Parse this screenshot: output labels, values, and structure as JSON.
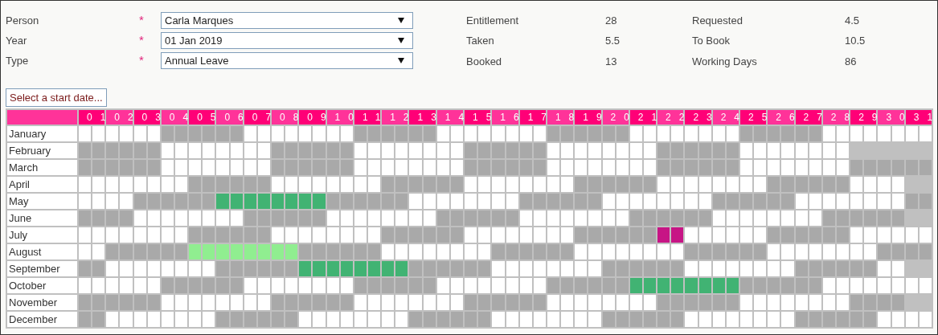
{
  "form": [
    {
      "label": "Person",
      "required_mark": "*",
      "value": "Carla Marques"
    },
    {
      "label": "Year",
      "required_mark": "*",
      "value": "01 Jan 2019"
    },
    {
      "label": "Type",
      "required_mark": "*",
      "value": "Annual Leave"
    }
  ],
  "stats": [
    {
      "label": "Entitlement",
      "value": "28"
    },
    {
      "label": "Requested",
      "value": "4.5"
    },
    {
      "label": "Taken",
      "value": "5.5"
    },
    {
      "label": "To Book",
      "value": "10.5"
    },
    {
      "label": "Booked",
      "value": "13"
    },
    {
      "label": "Working Days",
      "value": "86"
    }
  ],
  "start_button": "Select a start date...",
  "day_headers": [
    "01",
    "02",
    "03",
    "04",
    "05",
    "06",
    "07",
    "08",
    "09",
    "10",
    "11",
    "12",
    "13",
    "14",
    "15",
    "16",
    "17",
    "18",
    "19",
    "20",
    "21",
    "22",
    "23",
    "24",
    "25",
    "26",
    "27",
    "28",
    "29",
    "30",
    "31"
  ],
  "months": [
    {
      "name": "January",
      "days": [
        {
          "kind": "work"
        },
        {
          "kind": "work"
        },
        {
          "kind": "work"
        },
        {
          "kind": "off"
        },
        {
          "kind": "off"
        },
        {
          "kind": "off"
        },
        {
          "kind": "work"
        },
        {
          "kind": "work"
        },
        {
          "kind": "work"
        },
        {
          "kind": "work"
        },
        {
          "kind": "off"
        },
        {
          "kind": "off"
        },
        {
          "kind": "off"
        },
        {
          "kind": "work"
        },
        {
          "kind": "work"
        },
        {
          "kind": "work"
        },
        {
          "kind": "work"
        },
        {
          "kind": "off"
        },
        {
          "kind": "off"
        },
        {
          "kind": "off"
        },
        {
          "kind": "work"
        },
        {
          "kind": "work"
        },
        {
          "kind": "work"
        },
        {
          "kind": "work"
        },
        {
          "kind": "off"
        },
        {
          "kind": "off"
        },
        {
          "kind": "off"
        },
        {
          "kind": "work"
        },
        {
          "kind": "work"
        },
        {
          "kind": "work"
        },
        {
          "kind": "work"
        }
      ]
    },
    {
      "name": "February",
      "days": [
        {
          "kind": "off"
        },
        {
          "kind": "off"
        },
        {
          "kind": "off"
        },
        {
          "kind": "work"
        },
        {
          "kind": "work"
        },
        {
          "kind": "work"
        },
        {
          "kind": "work"
        },
        {
          "kind": "off"
        },
        {
          "kind": "off"
        },
        {
          "kind": "off"
        },
        {
          "kind": "work"
        },
        {
          "kind": "work"
        },
        {
          "kind": "work"
        },
        {
          "kind": "work"
        },
        {
          "kind": "off"
        },
        {
          "kind": "off"
        },
        {
          "kind": "off"
        },
        {
          "kind": "work"
        },
        {
          "kind": "work"
        },
        {
          "kind": "work"
        },
        {
          "kind": "work"
        },
        {
          "kind": "off"
        },
        {
          "kind": "off"
        },
        {
          "kind": "off"
        },
        {
          "kind": "work"
        },
        {
          "kind": "work"
        },
        {
          "kind": "work"
        },
        {
          "kind": "work"
        },
        {
          "kind": "none"
        },
        {
          "kind": "none"
        },
        {
          "kind": "none"
        }
      ]
    },
    {
      "name": "March",
      "days": [
        {
          "kind": "off"
        },
        {
          "kind": "off"
        },
        {
          "kind": "off"
        },
        {
          "kind": "work"
        },
        {
          "kind": "work"
        },
        {
          "kind": "work"
        },
        {
          "kind": "work"
        },
        {
          "kind": "off"
        },
        {
          "kind": "off"
        },
        {
          "kind": "off"
        },
        {
          "kind": "work"
        },
        {
          "kind": "work"
        },
        {
          "kind": "work"
        },
        {
          "kind": "work"
        },
        {
          "kind": "off"
        },
        {
          "kind": "off"
        },
        {
          "kind": "off"
        },
        {
          "kind": "work"
        },
        {
          "kind": "work"
        },
        {
          "kind": "work"
        },
        {
          "kind": "work"
        },
        {
          "kind": "off"
        },
        {
          "kind": "off"
        },
        {
          "kind": "off"
        },
        {
          "kind": "work"
        },
        {
          "kind": "work"
        },
        {
          "kind": "work"
        },
        {
          "kind": "work"
        },
        {
          "kind": "off"
        },
        {
          "kind": "off"
        },
        {
          "kind": "off"
        }
      ]
    },
    {
      "name": "April",
      "days": [
        {
          "kind": "work"
        },
        {
          "kind": "work"
        },
        {
          "kind": "work"
        },
        {
          "kind": "work"
        },
        {
          "kind": "off"
        },
        {
          "kind": "off"
        },
        {
          "kind": "off"
        },
        {
          "kind": "work"
        },
        {
          "kind": "work"
        },
        {
          "kind": "work"
        },
        {
          "kind": "work"
        },
        {
          "kind": "off"
        },
        {
          "kind": "off"
        },
        {
          "kind": "off"
        },
        {
          "kind": "work"
        },
        {
          "kind": "work"
        },
        {
          "kind": "work"
        },
        {
          "kind": "work"
        },
        {
          "kind": "off"
        },
        {
          "kind": "off"
        },
        {
          "kind": "off"
        },
        {
          "kind": "work"
        },
        {
          "kind": "work"
        },
        {
          "kind": "work"
        },
        {
          "kind": "work"
        },
        {
          "kind": "off"
        },
        {
          "kind": "off"
        },
        {
          "kind": "off"
        },
        {
          "kind": "work"
        },
        {
          "kind": "work"
        },
        {
          "kind": "none"
        }
      ]
    },
    {
      "name": "May",
      "days": [
        {
          "kind": "work"
        },
        {
          "kind": "work"
        },
        {
          "kind": "off"
        },
        {
          "kind": "off"
        },
        {
          "kind": "off"
        },
        {
          "kind": "booked"
        },
        {
          "kind": "booked"
        },
        {
          "kind": "booked"
        },
        {
          "kind": "booked"
        },
        {
          "kind": "off"
        },
        {
          "kind": "off"
        },
        {
          "kind": "off"
        },
        {
          "kind": "work"
        },
        {
          "kind": "work"
        },
        {
          "kind": "work"
        },
        {
          "kind": "work"
        },
        {
          "kind": "off"
        },
        {
          "kind": "off"
        },
        {
          "kind": "off"
        },
        {
          "kind": "work"
        },
        {
          "kind": "work"
        },
        {
          "kind": "work"
        },
        {
          "kind": "work"
        },
        {
          "kind": "off"
        },
        {
          "kind": "off"
        },
        {
          "kind": "off"
        },
        {
          "kind": "work"
        },
        {
          "kind": "work"
        },
        {
          "kind": "work"
        },
        {
          "kind": "work"
        },
        {
          "kind": "off"
        }
      ]
    },
    {
      "name": "June",
      "days": [
        {
          "kind": "off"
        },
        {
          "kind": "off"
        },
        {
          "kind": "work"
        },
        {
          "kind": "work"
        },
        {
          "kind": "work"
        },
        {
          "kind": "work"
        },
        {
          "kind": "off"
        },
        {
          "kind": "off"
        },
        {
          "kind": "off"
        },
        {
          "kind": "work"
        },
        {
          "kind": "work"
        },
        {
          "kind": "work"
        },
        {
          "kind": "work"
        },
        {
          "kind": "off"
        },
        {
          "kind": "off"
        },
        {
          "kind": "off"
        },
        {
          "kind": "work"
        },
        {
          "kind": "work"
        },
        {
          "kind": "work"
        },
        {
          "kind": "work"
        },
        {
          "kind": "off"
        },
        {
          "kind": "off"
        },
        {
          "kind": "off"
        },
        {
          "kind": "work"
        },
        {
          "kind": "work"
        },
        {
          "kind": "work"
        },
        {
          "kind": "work"
        },
        {
          "kind": "off"
        },
        {
          "kind": "off"
        },
        {
          "kind": "off"
        },
        {
          "kind": "none"
        }
      ]
    },
    {
      "name": "July",
      "days": [
        {
          "kind": "work"
        },
        {
          "kind": "work"
        },
        {
          "kind": "work"
        },
        {
          "kind": "work"
        },
        {
          "kind": "off"
        },
        {
          "kind": "off"
        },
        {
          "kind": "off"
        },
        {
          "kind": "work"
        },
        {
          "kind": "work"
        },
        {
          "kind": "work"
        },
        {
          "kind": "work"
        },
        {
          "kind": "off"
        },
        {
          "kind": "off"
        },
        {
          "kind": "off"
        },
        {
          "kind": "work"
        },
        {
          "kind": "work"
        },
        {
          "kind": "work"
        },
        {
          "kind": "work"
        },
        {
          "kind": "off"
        },
        {
          "kind": "off"
        },
        {
          "kind": "off"
        },
        {
          "kind": "requested"
        },
        {
          "kind": "work"
        },
        {
          "kind": "work"
        },
        {
          "kind": "work"
        },
        {
          "kind": "off"
        },
        {
          "kind": "off"
        },
        {
          "kind": "off"
        },
        {
          "kind": "work"
        },
        {
          "kind": "work"
        },
        {
          "kind": "work"
        }
      ]
    },
    {
      "name": "August",
      "days": [
        {
          "kind": "work"
        },
        {
          "kind": "off"
        },
        {
          "kind": "off"
        },
        {
          "kind": "off"
        },
        {
          "kind": "taken"
        },
        {
          "kind": "taken"
        },
        {
          "kind": "taken"
        },
        {
          "kind": "taken"
        },
        {
          "kind": "off"
        },
        {
          "kind": "off"
        },
        {
          "kind": "off"
        },
        {
          "kind": "work"
        },
        {
          "kind": "work"
        },
        {
          "kind": "work"
        },
        {
          "kind": "work"
        },
        {
          "kind": "off"
        },
        {
          "kind": "off"
        },
        {
          "kind": "off"
        },
        {
          "kind": "work"
        },
        {
          "kind": "work"
        },
        {
          "kind": "work"
        },
        {
          "kind": "work"
        },
        {
          "kind": "off"
        },
        {
          "kind": "off"
        },
        {
          "kind": "off"
        },
        {
          "kind": "work"
        },
        {
          "kind": "work"
        },
        {
          "kind": "work"
        },
        {
          "kind": "work"
        },
        {
          "kind": "off"
        },
        {
          "kind": "off"
        }
      ]
    },
    {
      "name": "September",
      "days": [
        {
          "kind": "off"
        },
        {
          "kind": "work"
        },
        {
          "kind": "work"
        },
        {
          "kind": "work"
        },
        {
          "kind": "work"
        },
        {
          "kind": "off"
        },
        {
          "kind": "off"
        },
        {
          "kind": "off"
        },
        {
          "kind": "booked"
        },
        {
          "kind": "booked"
        },
        {
          "kind": "booked"
        },
        {
          "kind": "booked"
        },
        {
          "kind": "off"
        },
        {
          "kind": "off"
        },
        {
          "kind": "off"
        },
        {
          "kind": "work"
        },
        {
          "kind": "work"
        },
        {
          "kind": "work"
        },
        {
          "kind": "work"
        },
        {
          "kind": "off"
        },
        {
          "kind": "off"
        },
        {
          "kind": "off"
        },
        {
          "kind": "work"
        },
        {
          "kind": "work"
        },
        {
          "kind": "work"
        },
        {
          "kind": "work"
        },
        {
          "kind": "off"
        },
        {
          "kind": "off"
        },
        {
          "kind": "off"
        },
        {
          "kind": "work"
        },
        {
          "kind": "none"
        }
      ]
    },
    {
      "name": "October",
      "days": [
        {
          "kind": "work"
        },
        {
          "kind": "work"
        },
        {
          "kind": "work"
        },
        {
          "kind": "off"
        },
        {
          "kind": "off"
        },
        {
          "kind": "off"
        },
        {
          "kind": "work"
        },
        {
          "kind": "work"
        },
        {
          "kind": "work"
        },
        {
          "kind": "work"
        },
        {
          "kind": "off"
        },
        {
          "kind": "off"
        },
        {
          "kind": "off"
        },
        {
          "kind": "work"
        },
        {
          "kind": "work"
        },
        {
          "kind": "work"
        },
        {
          "kind": "work"
        },
        {
          "kind": "off"
        },
        {
          "kind": "off"
        },
        {
          "kind": "off"
        },
        {
          "kind": "booked"
        },
        {
          "kind": "booked"
        },
        {
          "kind": "booked"
        },
        {
          "kind": "booked"
        },
        {
          "kind": "off"
        },
        {
          "kind": "off"
        },
        {
          "kind": "off"
        },
        {
          "kind": "work"
        },
        {
          "kind": "work"
        },
        {
          "kind": "work"
        },
        {
          "kind": "work"
        }
      ]
    },
    {
      "name": "November",
      "days": [
        {
          "kind": "off"
        },
        {
          "kind": "off"
        },
        {
          "kind": "off"
        },
        {
          "kind": "work"
        },
        {
          "kind": "work"
        },
        {
          "kind": "work"
        },
        {
          "kind": "work"
        },
        {
          "kind": "off"
        },
        {
          "kind": "off"
        },
        {
          "kind": "off"
        },
        {
          "kind": "work"
        },
        {
          "kind": "work"
        },
        {
          "kind": "work"
        },
        {
          "kind": "work"
        },
        {
          "kind": "off"
        },
        {
          "kind": "off"
        },
        {
          "kind": "off"
        },
        {
          "kind": "work"
        },
        {
          "kind": "work"
        },
        {
          "kind": "work"
        },
        {
          "kind": "work"
        },
        {
          "kind": "off"
        },
        {
          "kind": "off"
        },
        {
          "kind": "off"
        },
        {
          "kind": "work"
        },
        {
          "kind": "work"
        },
        {
          "kind": "work"
        },
        {
          "kind": "work"
        },
        {
          "kind": "off"
        },
        {
          "kind": "off"
        },
        {
          "kind": "none"
        }
      ]
    },
    {
      "name": "December",
      "days": [
        {
          "kind": "off"
        },
        {
          "kind": "work"
        },
        {
          "kind": "work"
        },
        {
          "kind": "work"
        },
        {
          "kind": "work"
        },
        {
          "kind": "off"
        },
        {
          "kind": "off"
        },
        {
          "kind": "off"
        },
        {
          "kind": "work"
        },
        {
          "kind": "work"
        },
        {
          "kind": "work"
        },
        {
          "kind": "work"
        },
        {
          "kind": "off"
        },
        {
          "kind": "off"
        },
        {
          "kind": "off"
        },
        {
          "kind": "work"
        },
        {
          "kind": "work"
        },
        {
          "kind": "work"
        },
        {
          "kind": "work"
        },
        {
          "kind": "off"
        },
        {
          "kind": "off"
        },
        {
          "kind": "off"
        },
        {
          "kind": "work"
        },
        {
          "kind": "work"
        },
        {
          "kind": "work"
        },
        {
          "kind": "work"
        },
        {
          "kind": "off"
        },
        {
          "kind": "off"
        },
        {
          "kind": "off"
        },
        {
          "kind": "work"
        },
        {
          "kind": "work"
        }
      ]
    }
  ]
}
